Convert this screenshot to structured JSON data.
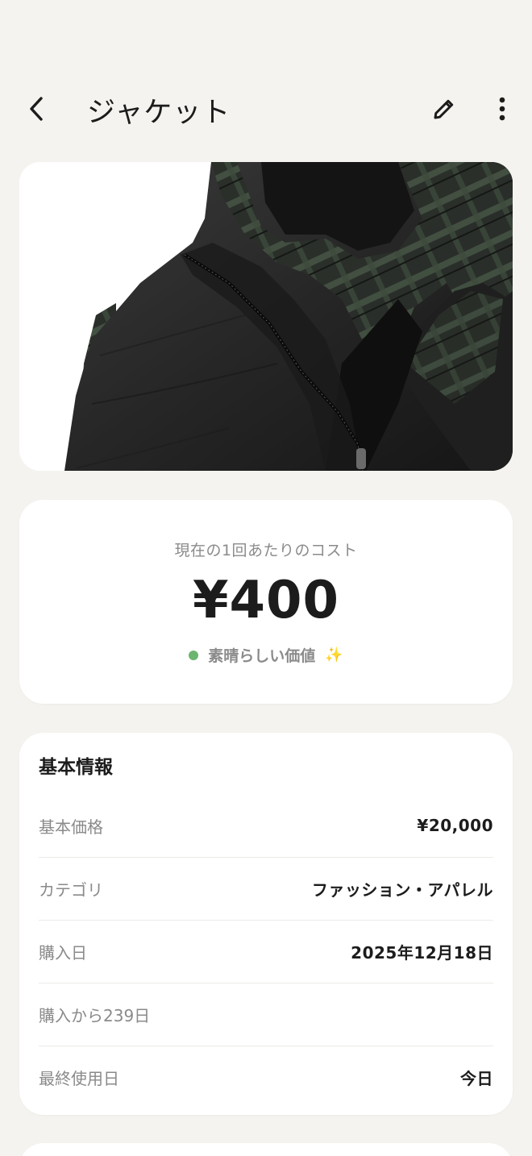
{
  "app_bar": {
    "title": "ジャケット",
    "back_icon": "chevron-left-icon",
    "edit_icon": "pencil-icon",
    "more_icon": "more-vertical-icon"
  },
  "hero_image": {
    "description": "black down jacket"
  },
  "cost_card": {
    "label": "現在の1回あたりのコスト",
    "value": "¥400",
    "status_text": "素晴らしい価値",
    "status_color": "#6bb56e",
    "sparkle": "✨"
  },
  "info_card": {
    "title": "基本情報",
    "rows": [
      {
        "key": "基本価格",
        "value": "¥20,000"
      },
      {
        "key": "カテゴリ",
        "value": "ファッション・アパレル"
      },
      {
        "key": "購入日",
        "value": "2025年12月18日"
      },
      {
        "key": "購入から239日",
        "value": ""
      },
      {
        "key": "最終使用日",
        "value": "今日"
      }
    ]
  },
  "colors": {
    "background": "#f4f3ef",
    "card": "#ffffff",
    "text_primary": "#1c1c1c",
    "text_secondary": "#8b8b8b"
  }
}
